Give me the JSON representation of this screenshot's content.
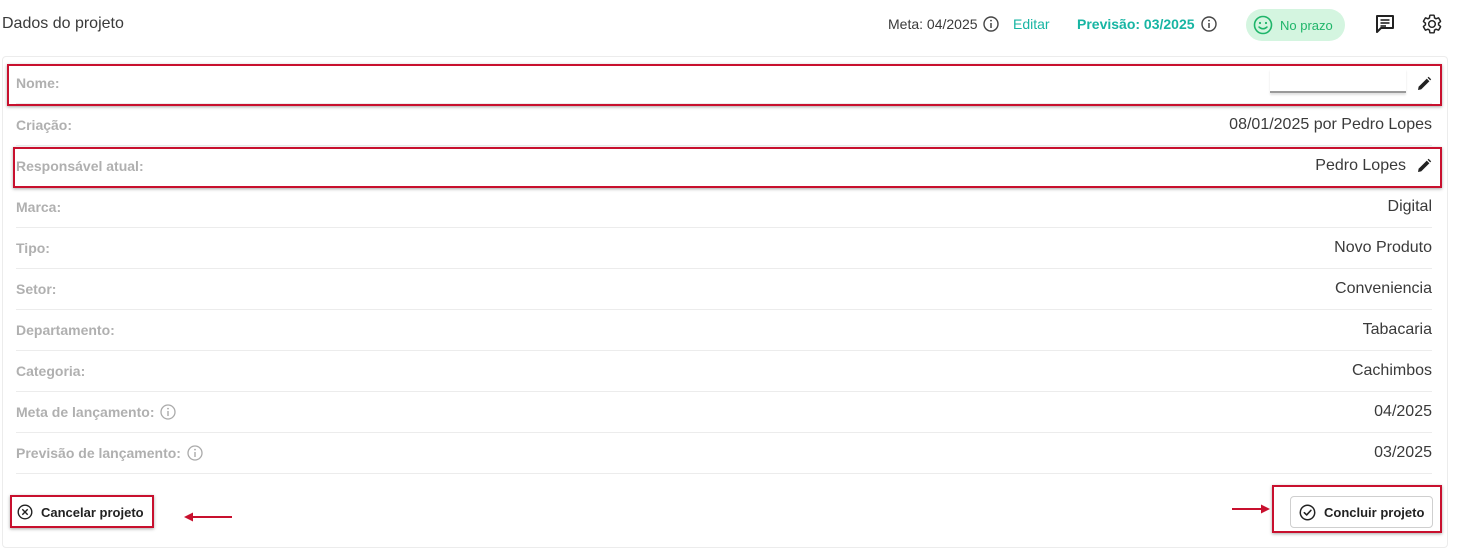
{
  "header": {
    "title": "Dados do projeto",
    "meta_label": "Meta: 04/2025",
    "edit_label": "Editar",
    "forecast_label": "Previsão: 03/2025",
    "status_label": "No prazo"
  },
  "fields": [
    {
      "label": "Nome:",
      "value": ""
    },
    {
      "label": "Criação:",
      "value": "08/01/2025 por Pedro Lopes"
    },
    {
      "label": "Responsável atual:",
      "value": "Pedro Lopes"
    },
    {
      "label": "Marca:",
      "value": "Digital"
    },
    {
      "label": "Tipo:",
      "value": "Novo Produto"
    },
    {
      "label": "Setor:",
      "value": "Conveniencia"
    },
    {
      "label": "Departamento:",
      "value": "Tabacaria"
    },
    {
      "label": "Categoria:",
      "value": "Cachimbos"
    },
    {
      "label": "Meta de lançamento:",
      "value": "04/2025"
    },
    {
      "label": "Previsão de lançamento:",
      "value": "03/2025"
    }
  ],
  "actions": {
    "cancel_label": "Cancelar projeto",
    "conclude_label": "Concluir projeto"
  },
  "colors": {
    "accent": "#17b5a3",
    "status_bg": "#d4f5e0",
    "status_text": "#1fb56a",
    "highlight": "#c8102e"
  },
  "icons": [
    "info-icon",
    "smiley-icon",
    "chat-icon",
    "gear-icon",
    "pencil-icon",
    "cancel-circle-icon",
    "check-circle-icon",
    "arrow-icon"
  ]
}
